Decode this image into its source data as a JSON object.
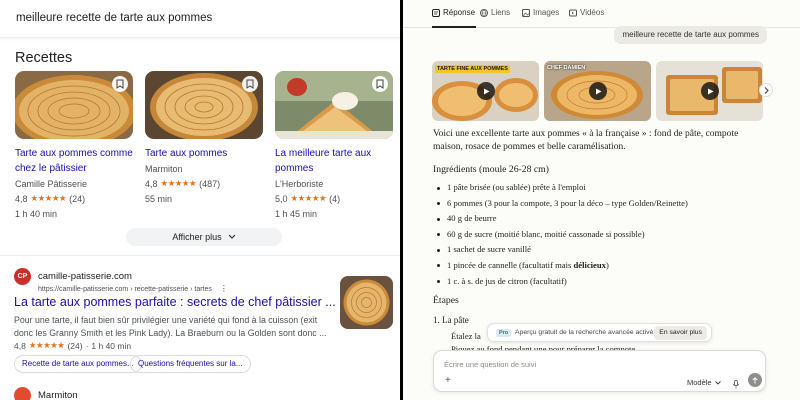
{
  "google": {
    "search_query": "meilleure recette de tarte aux pommes",
    "recipes_heading": "Recettes",
    "recipes": [
      {
        "title": "Tarte aux pommes comme chez le pâtissier",
        "source": "Camille Pâtisserie",
        "rating": "4,8",
        "stars": "★★★★★",
        "reviews": "(24)",
        "time": "1 h 40 min"
      },
      {
        "title": "Tarte aux pommes",
        "source": "Marmiton",
        "rating": "4,8",
        "stars": "★★★★★",
        "reviews": "(487)",
        "time": "55 min"
      },
      {
        "title": "La meilleure tarte aux pommes",
        "source": "L'Herboriste",
        "rating": "5,0",
        "stars": "★★★★★",
        "reviews": "(4)",
        "time": "1 h 45 min"
      }
    ],
    "show_more": "Afficher plus",
    "result": {
      "favicon_text": "CP",
      "site": "camille-patisserie.com",
      "url": "https://camille-patisserie.com › recette-patisserie › tartes",
      "title": "La tarte aux pommes parfaite : secrets de chef pâtissier ...",
      "snippet": "Pour une tarte, il faut bien sûr privilégier une variété qui fond à la cuisson (exit donc les Granny Smith et les Pink Lady). La Braeburn ou la Golden sont donc ...",
      "rating": "4,8",
      "stars": "★★★★★",
      "reviews": "(24)",
      "time": "1 h 40 min",
      "chips": [
        "Recette de tarte aux pommes...",
        "Questions fréquentes sur la..."
      ]
    },
    "result2_site": "Marmiton"
  },
  "assistant": {
    "tabs": [
      {
        "label": "Réponse",
        "icon": "answer-icon"
      },
      {
        "label": "Liens",
        "icon": "globe-icon"
      },
      {
        "label": "Images",
        "icon": "image-icon"
      },
      {
        "label": "Vidéos",
        "icon": "video-icon"
      }
    ],
    "query": "meilleure recette de tarte aux pommes",
    "video_labels": [
      "TARTE FINE AUX POMMES",
      "CHEF DAMIEN"
    ],
    "intro": "Voici une excellente tarte aux pommes « à la française » : fond de pâte, compote maison, rosace de pommes et belle caramélisation.",
    "ingredients_heading": "Ingrédients (moule 26-28 cm)",
    "ingredients": [
      "1 pâte brisée (ou sablée) prête à l'emploi",
      "6 pommes (3 pour la compote, 3 pour la déco – type Golden/Reinette)",
      "40 g de beurre",
      "60 g de sucre (moitié blanc, moitié cassonade si possible)",
      "1 sachet de sucre vanillé",
      "1 pincée de cannelle (facultatif mais ",
      "1 c. à s. de jus de citron (facultatif)"
    ],
    "ingredient_bold": "délicieux",
    "ingredient_bold_tail": ")",
    "steps_heading": "Étapes",
    "step1": "1. La pâte",
    "step1_sub": "Étalez la",
    "step1_behind": "Piquez au fond pendant une pour préparer la compote",
    "promo": {
      "badge": "Pro",
      "text": "Aperçu gratuit de la recherche avancée activé.",
      "button": "En savoir plus"
    },
    "followup": {
      "placeholder": "Écrire une question de suivi",
      "model": "Modèle"
    },
    "colors": {
      "accent": "#1f1f1f",
      "link": "#1a0dab",
      "star": "#e7711b"
    }
  }
}
